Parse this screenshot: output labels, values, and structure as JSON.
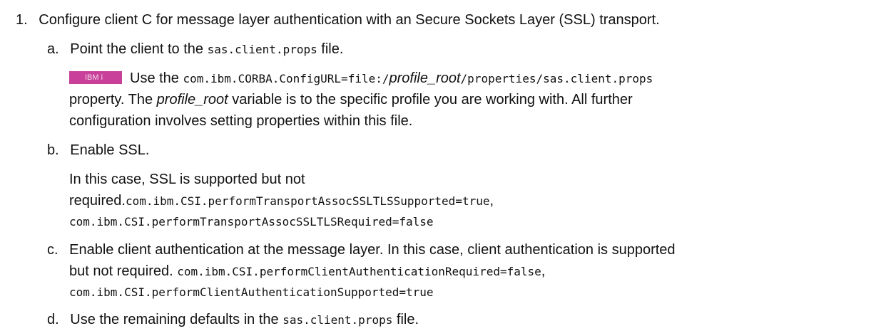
{
  "step1": {
    "number": "1.",
    "text": "Configure client C for message layer authentication with an Secure Sockets Layer (SSL) transport."
  },
  "sub_a": {
    "letter": "a.",
    "text_pre": "Point the client to the",
    "file": "sas.client.props",
    "text_post": "file.",
    "badge_label": "IBM i",
    "badge_color": "#c8409a",
    "line1_pre": "Use the",
    "code_pre": "com.ibm.CORBA.ConfigURL=file:/",
    "code_var": "profile_root",
    "code_post": "/properties/sas.client.props",
    "line2_pre": "property. The",
    "line2_var": "profile_root",
    "line2_post": "variable is to the specific profile you are working with. All further",
    "line3": "configuration involves setting properties within this file."
  },
  "sub_b": {
    "letter": "b.",
    "text": "Enable SSL.",
    "line1": "In this case, SSL is supported but not",
    "line2_text": "required.",
    "line2_code": "com.ibm.CSI.performTransportAssocSSLTLSSupported=true",
    "line2_comma": ",",
    "line3_code": "com.ibm.CSI.performTransportAssocSSLTLSRequired=false"
  },
  "sub_c": {
    "letter": "c.",
    "line1": "Enable client authentication at the message layer. In this case, client authentication is supported",
    "line2_text": "but not required.",
    "line2_code": "com.ibm.CSI.performClientAuthenticationRequired=false",
    "line2_comma": ",",
    "line3_code": "com.ibm.CSI.performClientAuthenticationSupported=true"
  },
  "sub_d": {
    "letter": "d.",
    "text_pre": "Use the remaining defaults in the",
    "file": "sas.client.props",
    "text_post": "file."
  }
}
